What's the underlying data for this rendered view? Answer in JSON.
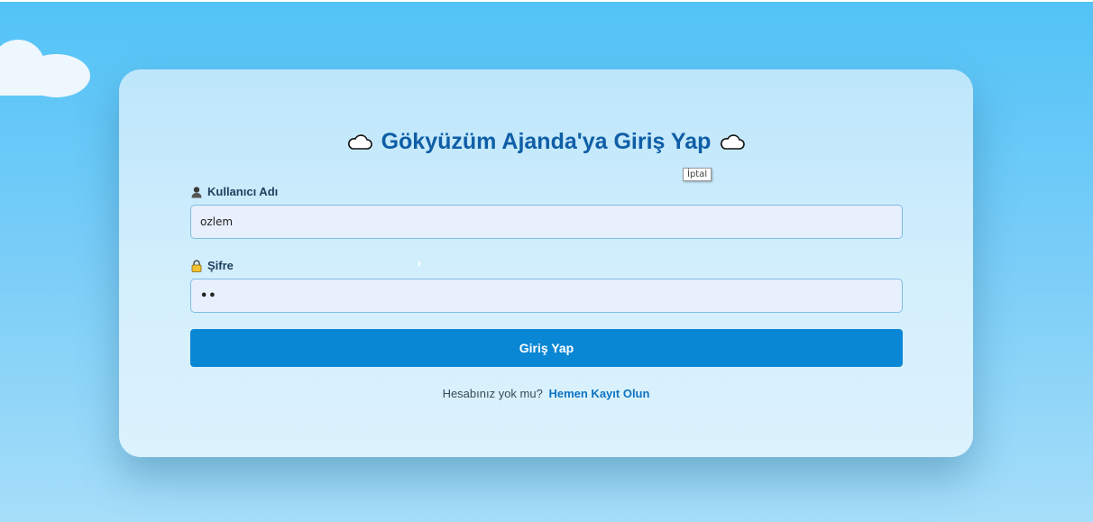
{
  "login": {
    "title": "Gökyüzüm Ajanda'ya Giriş Yap",
    "tooltip": "İptal",
    "username_label": "Kullanıcı Adı",
    "username_value": "ozlem",
    "password_label": "Şifre",
    "password_value": "••",
    "submit_label": "Giriş Yap",
    "signup_prompt": "Hesabınız yok mu?",
    "signup_link": "Hemen Kayıt Olun"
  },
  "colors": {
    "title": "#0f5ea6",
    "button": "#0a87d4",
    "link": "#0f73c2"
  },
  "icons": {
    "title_left": "cloud-icon",
    "title_right": "cloud-icon",
    "username": "user-icon",
    "password": "lock-icon"
  }
}
